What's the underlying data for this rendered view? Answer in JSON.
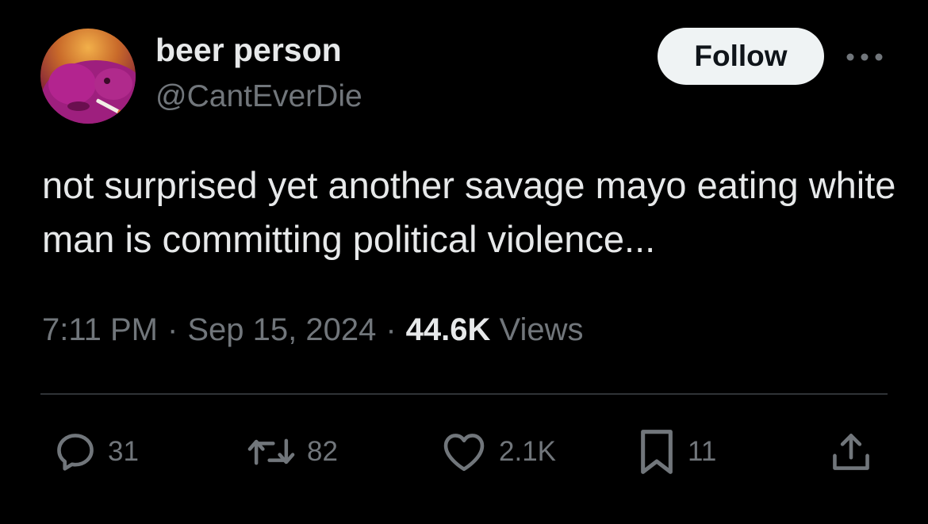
{
  "author": {
    "display_name": "beer person",
    "handle": "@CantEverDie",
    "avatar_icon": "avatar-image"
  },
  "follow_label": "Follow",
  "more_icon": "more-dots-icon",
  "tweet": {
    "text": "not surprised yet another savage mayo eating white man is committing political violence..."
  },
  "meta": {
    "time": "7:11 PM",
    "date": "Sep 15, 2024",
    "separator": "·",
    "views_count": "44.6K",
    "views_label": "Views"
  },
  "actions": {
    "replies": "31",
    "reposts": "82",
    "likes": "2.1K",
    "bookmarks": "11"
  },
  "colors": {
    "background": "#000000",
    "primary_text": "#e7e9ea",
    "secondary_text": "#71767b",
    "divider": "#2f3336",
    "follow_bg": "#eff3f4"
  }
}
